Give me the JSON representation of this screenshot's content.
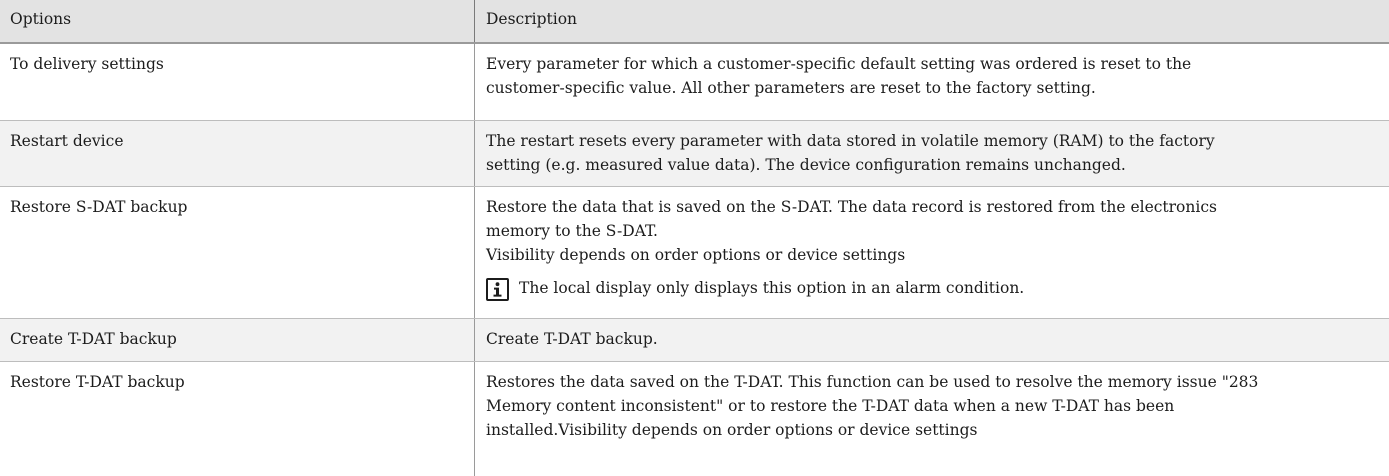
{
  "table": {
    "header": {
      "options": "Options",
      "description": "Description"
    },
    "rows": [
      {
        "option": "To delivery settings",
        "lines": [
          "Every parameter for which a customer-specific default setting was ordered is reset to the",
          "customer-specific value. All other parameters are reset to the factory setting."
        ]
      },
      {
        "option": "Restart device",
        "lines": [
          "The restart resets every parameter with data stored in volatile memory (RAM) to the factory",
          "setting (e.g. measured value data). The device configuration remains unchanged."
        ]
      },
      {
        "option": "Restore S-DAT backup",
        "lines": [
          "Restore the data that is saved on the S-DAT. The data record is restored from the electronics",
          "memory to the S-DAT.",
          "Visibility depends on order options or device settings"
        ],
        "note": {
          "icon": "info-icon",
          "text": "The local display only displays this option in an alarm condition."
        }
      },
      {
        "option": "Create T-DAT backup",
        "lines": [
          "Create T-DAT backup."
        ]
      },
      {
        "option": "Restore T-DAT backup",
        "lines": [
          "Restores the data saved on the T-DAT. This function can be used to resolve the memory issue \"283",
          "Memory content inconsistent\" or to restore the T-DAT data when a new T-DAT has been",
          "installed.Visibility depends on order options or device settings"
        ]
      }
    ]
  }
}
